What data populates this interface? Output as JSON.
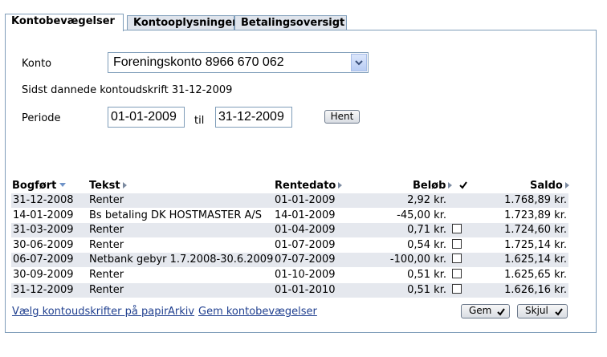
{
  "tabs": [
    "Kontobevægelser",
    "Kontooplysninger",
    "Betalingsoversigt"
  ],
  "form": {
    "konto_label": "Konto",
    "konto_value": "Foreningskonto 8966 670 062",
    "last_statement": "Sidst dannede kontoudskrift 31-12-2009",
    "periode_label": "Periode",
    "from_date": "01-01-2009",
    "til_label": "til",
    "to_date": "31-12-2009",
    "hent_label": "Hent"
  },
  "table": {
    "headers": {
      "bogfort": "Bogført",
      "tekst": "Tekst",
      "rentedato": "Rentedato",
      "belob": "Beløb",
      "saldo": "Saldo"
    },
    "rows": [
      {
        "bogfort": "31-12-2008",
        "tekst": "Renter",
        "rentedato": "01-01-2009",
        "belob": "2,92 kr.",
        "saldo": "1.768,89 kr.",
        "checkbox": false
      },
      {
        "bogfort": "14-01-2009",
        "tekst": "Bs betaling DK HOSTMASTER A/S",
        "rentedato": "14-01-2009",
        "belob": "-45,00 kr.",
        "saldo": "1.723,89 kr.",
        "checkbox": false
      },
      {
        "bogfort": "31-03-2009",
        "tekst": "Renter",
        "rentedato": "01-04-2009",
        "belob": "0,71 kr.",
        "saldo": "1.724,60 kr.",
        "checkbox": true
      },
      {
        "bogfort": "30-06-2009",
        "tekst": "Renter",
        "rentedato": "01-07-2009",
        "belob": "0,54 kr.",
        "saldo": "1.725,14 kr.",
        "checkbox": true
      },
      {
        "bogfort": "06-07-2009",
        "tekst": "Netbank gebyr 1.7.2008-30.6.2009",
        "rentedato": "07-07-2009",
        "belob": "-100,00 kr.",
        "saldo": "1.625,14 kr.",
        "checkbox": true
      },
      {
        "bogfort": "30-09-2009",
        "tekst": "Renter",
        "rentedato": "01-10-2009",
        "belob": "0,51 kr.",
        "saldo": "1.625,65 kr.",
        "checkbox": true
      },
      {
        "bogfort": "31-12-2009",
        "tekst": "Renter",
        "rentedato": "01-01-2010",
        "belob": "0,51 kr.",
        "saldo": "1.626,16 kr.",
        "checkbox": true
      }
    ]
  },
  "footer": {
    "links": [
      "Vælg kontoudskrifter på papir",
      "Arkiv",
      "Gem kontobevægelser"
    ],
    "gem_label": "Gem",
    "skjul_label": "Skjul"
  }
}
